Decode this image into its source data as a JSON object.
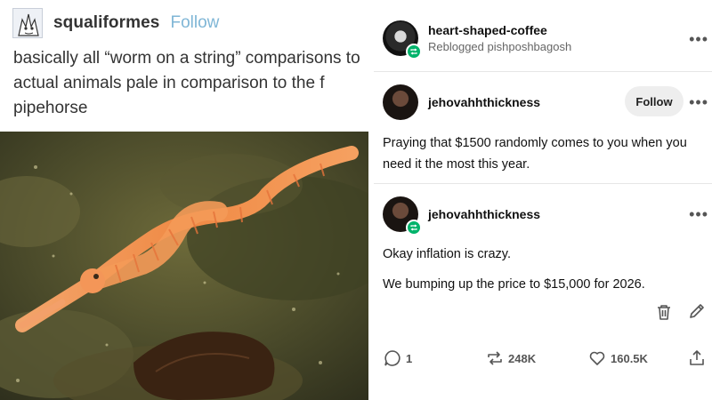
{
  "left_post": {
    "username": "squaliformes",
    "follow_label": "Follow",
    "text_lines": [
      "basically all “worm on a string” comparisons to",
      "actual animals pale in comparison to the f",
      "pipehorse"
    ],
    "photo_description_icon": "pipehorse-photo"
  },
  "right_feed": {
    "reblog_header": {
      "username": "heart-shaped-coffee",
      "reblogged_prefix": "Reblogged",
      "reblogged_from": "pishposhbagosh",
      "more_label": "•••"
    },
    "post_1": {
      "username": "jehovahhthickness",
      "follow_label": "Follow",
      "more_label": "•••",
      "text": "Praying that $1500 randomly comes to you when you need it the most this year."
    },
    "post_2": {
      "username": "jehovahhthickness",
      "more_label": "•••",
      "paragraph_1": "Okay inflation is crazy.",
      "paragraph_2": "We bumping up the price to $15,000 for 2026."
    },
    "footer": {
      "comments": "1",
      "reblogs": "248K",
      "likes": "160.5K"
    },
    "colors": {
      "reblog_green": "#00b36b",
      "follow_link": "#7fb6d6"
    }
  }
}
